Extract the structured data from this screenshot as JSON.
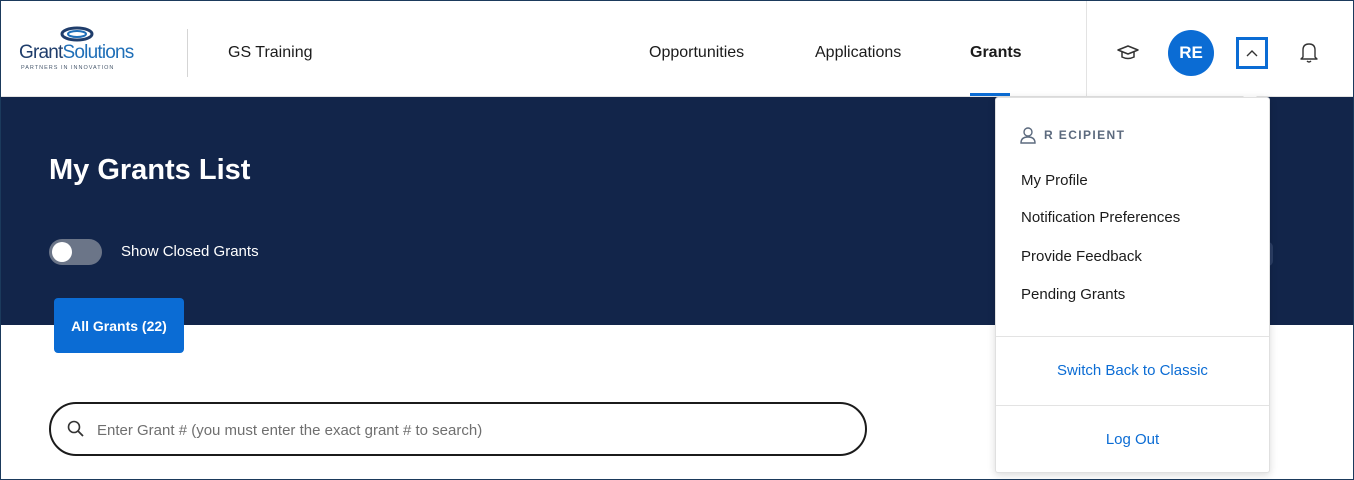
{
  "header": {
    "logo": {
      "brand_prefix": "Grant",
      "brand_suffix": "Solutions",
      "tagline": "PARTNERS IN INNOVATION"
    },
    "app_title": "GS Training",
    "nav": [
      {
        "label": "Opportunities",
        "active": false
      },
      {
        "label": "Applications",
        "active": false
      },
      {
        "label": "Grants",
        "active": true
      }
    ],
    "avatar_initials": "RE",
    "icons": [
      "graduation-cap-icon",
      "chevron-up-icon",
      "bell-icon"
    ]
  },
  "banner": {
    "title": "My Grants List",
    "toggle": {
      "label": "Show Closed Grants",
      "on": false
    }
  },
  "tabs": [
    {
      "label": "All Grants (22)"
    }
  ],
  "search": {
    "placeholder": "Enter Grant # (you must enter the exact grant # to search)",
    "value": ""
  },
  "user_menu": {
    "user_name": "R ECIPIENT",
    "items": [
      "My Profile",
      "Notification Preferences",
      "Provide Feedback",
      "Pending Grants"
    ],
    "switch_label": "Switch Back to Classic",
    "logout_label": "Log Out"
  },
  "colors": {
    "primary": "#0b6cd4",
    "banner": "#12254a",
    "text": "#1b1b1b"
  }
}
